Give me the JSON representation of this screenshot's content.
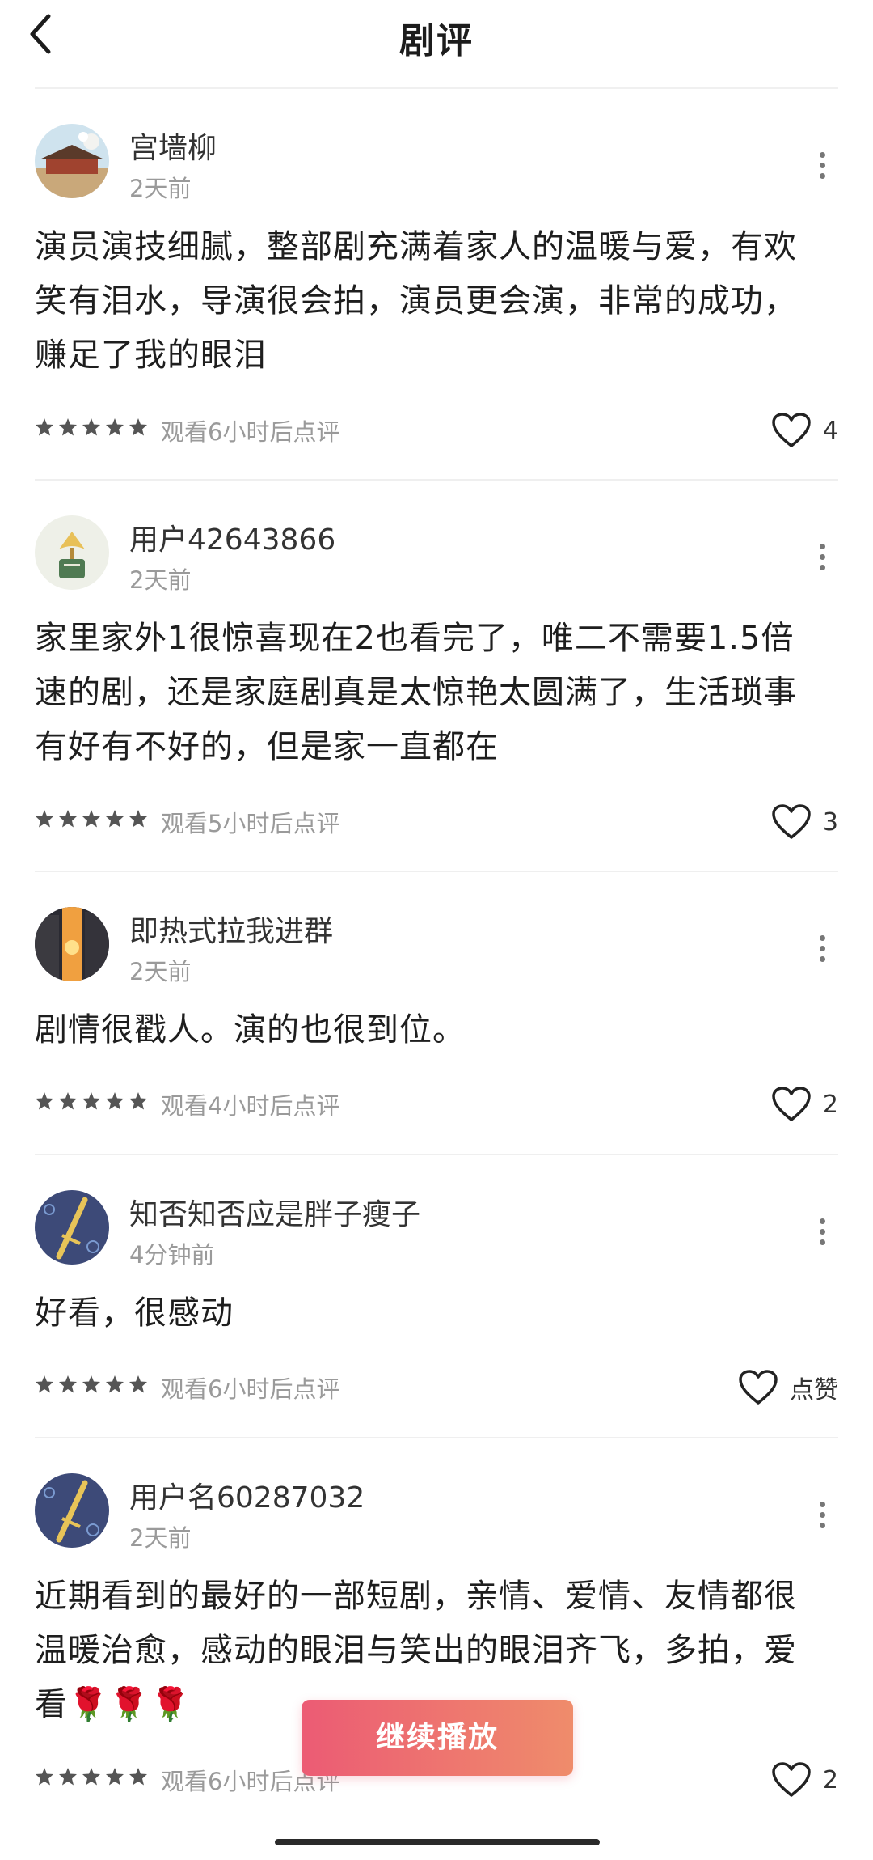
{
  "header": {
    "title": "剧评"
  },
  "reviews": [
    {
      "username": "宫墙柳",
      "time": "2天前",
      "content_lines": [
        "演员演技细腻，整部剧充满着家人的温暖与爱，有欢",
        "笑有泪水，导演很会拍，演员更会演，非常的成功，",
        "赚足了我的眼泪"
      ],
      "rating": 5,
      "watch_note": "观看6小时后点评",
      "like_label": "4",
      "avatar_icon": "palace-photo-avatar"
    },
    {
      "username": "用户42643866",
      "time": "2天前",
      "content_lines": [
        "家里家外1很惊喜现在2也看完了，唯二不需要1.5倍",
        "速的剧，还是家庭剧真是太惊艳太圆满了，生活琐事",
        "有好有不好的，但是家一直都在"
      ],
      "rating": 5,
      "watch_note": "观看5小时后点评",
      "like_label": "3",
      "avatar_icon": "ginkgo-cup-avatar"
    },
    {
      "username": "即热式拉我进群",
      "time": "2天前",
      "content_lines": [
        "剧情很戳人。演的也很到位。"
      ],
      "rating": 5,
      "watch_note": "观看4小时后点评",
      "like_label": "2",
      "avatar_icon": "city-sunset-avatar"
    },
    {
      "username": "知否知否应是胖子瘦子",
      "time": "4分钟前",
      "content_lines": [
        "好看，很感动"
      ],
      "rating": 5,
      "watch_note": "观看6小时后点评",
      "like_label": "点赞",
      "avatar_icon": "sword-avatar"
    },
    {
      "username": "用户名60287032",
      "time": "2天前",
      "content_lines": [
        "近期看到的最好的一部短剧，亲情、爱情、友情都很",
        "温暖治愈，感动的眼泪与笑出的眼泪齐飞，多拍，爱",
        "看🌹🌹🌹"
      ],
      "rating": 5,
      "watch_note": "观看6小时后点评",
      "like_label": "2",
      "avatar_icon": "sword-avatar"
    }
  ],
  "continue_button": {
    "label": "继续播放"
  },
  "colors": {
    "accent_start": "#ec5b74",
    "accent_end": "#ef8c6b",
    "muted": "#9a9a9a"
  }
}
